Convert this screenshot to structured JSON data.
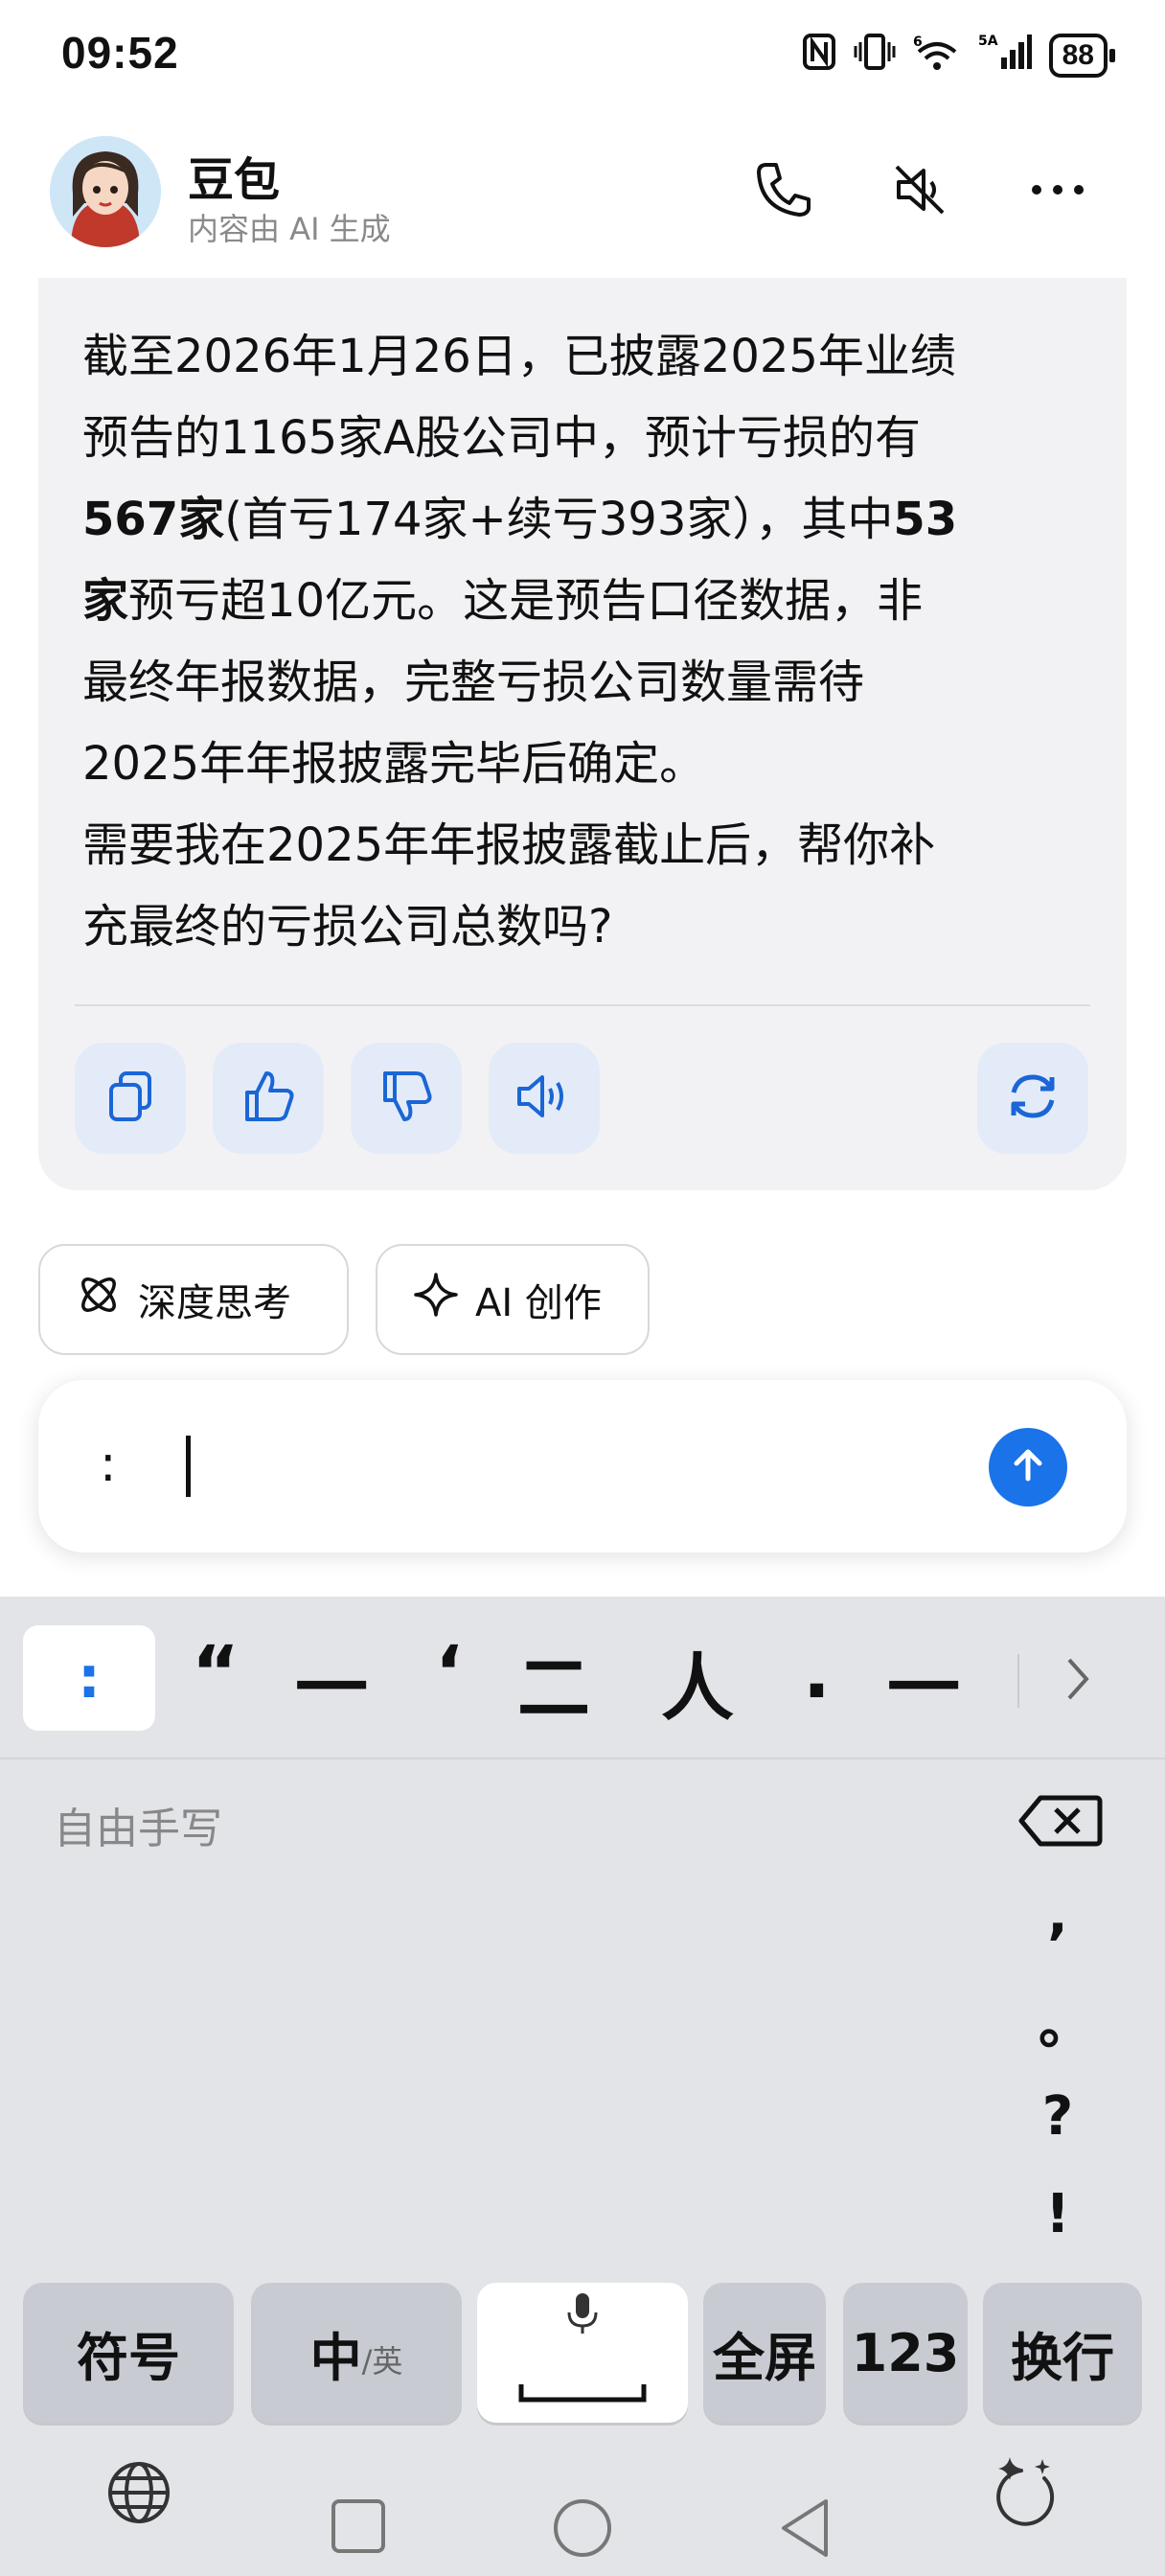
{
  "status": {
    "time": "09:52",
    "network_label": "5A",
    "battery": "88"
  },
  "header": {
    "name": "豆包",
    "subtitle": "内容由 AI 生成",
    "icons": [
      "phone-icon",
      "speaker-mute-icon",
      "more-icon"
    ]
  },
  "message": {
    "l1": "截至2026年1月26日，已披露2025年业绩",
    "l2": "预告的1165家A股公司中，预计亏损的有",
    "l3_bold": "567家",
    "l3_rest": "(首亏174家+续亏393家），其中",
    "l3_bold2": "53",
    "l4_bold": "家",
    "l4_rest": "预亏超10亿元。这是预告口径数据，非",
    "l5": "最终年报数据，完整亏损公司数量需待",
    "l6": "2025年年报披露完毕后确定。",
    "l7": "需要我在2025年年报披露截止后，帮你补",
    "l8": "充最终的亏损公司总数吗?"
  },
  "actions": [
    "copy-icon",
    "thumbs-up-icon",
    "thumbs-down-icon",
    "speaker-icon",
    "regenerate-icon"
  ],
  "chips": {
    "deep_think": "深度思考",
    "ai_create": "AI 创作"
  },
  "input": {
    "value": ":"
  },
  "keyboard": {
    "candidates": {
      "selected": ":",
      "c1": "“",
      "c2": "一",
      "c3": "‘",
      "c4": "二",
      "c5": "人",
      "c6": ".",
      "c7": "一"
    },
    "handwriting_label": "自由手写",
    "punct": {
      "comma": ",",
      "period": "。",
      "question": "?",
      "exclaim": "!"
    },
    "keys": {
      "symbol": "符号",
      "zh": "中",
      "en": "/英",
      "fullscreen": "全屏",
      "num": "123",
      "newline": "换行"
    }
  }
}
